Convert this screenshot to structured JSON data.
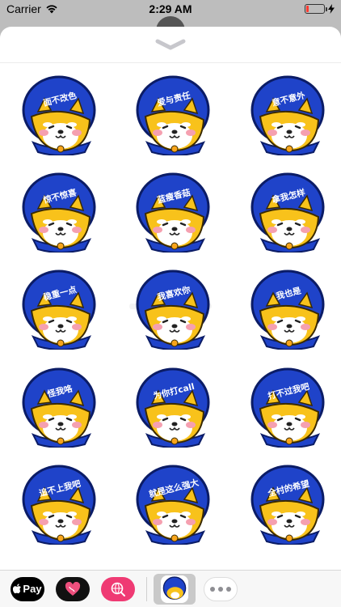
{
  "status_bar": {
    "carrier": "Carrier",
    "time": "2:29 AM",
    "battery_level_percent": 12
  },
  "sheet": {
    "grabber_icon": "chevron-down-icon"
  },
  "stickers": [
    {
      "label": "面不改色"
    },
    {
      "label": "爱与责任"
    },
    {
      "label": "意不意外"
    },
    {
      "label": "惊不惊喜"
    },
    {
      "label": "蓝瘦香菇"
    },
    {
      "label": "拿我怎样"
    },
    {
      "label": "稳重一点"
    },
    {
      "label": "我喜欢你"
    },
    {
      "label": "我也是"
    },
    {
      "label": "怪我咯"
    },
    {
      "label": "为你打call"
    },
    {
      "label": "打不过我吧"
    },
    {
      "label": "追不上我吧"
    },
    {
      "label": "就是这么强大"
    },
    {
      "label": "全村的希望"
    }
  ],
  "tray": {
    "apple_pay_label": "Pay",
    "apps": [
      "apple-pay-icon",
      "digital-touch-heart-icon",
      "image-search-icon",
      "shiba-sticker-app-icon",
      "more-icon"
    ],
    "colors": {
      "pink": "#ef3a73",
      "helmet_blue": "#1f43c9"
    }
  }
}
